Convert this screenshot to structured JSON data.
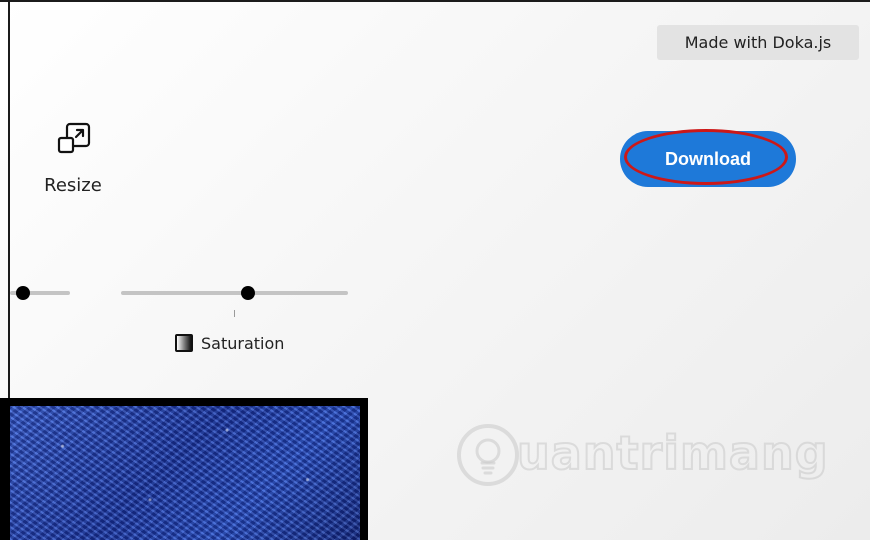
{
  "badge": {
    "text": "Made with Doka.js"
  },
  "tools": {
    "resize_label": "Resize"
  },
  "actions": {
    "download_label": "Download"
  },
  "adjustments": {
    "saturation_label": "Saturation",
    "left_slider_value": 0.22,
    "saturation_value": 0.56
  },
  "watermark": {
    "text": "uantrimang"
  },
  "colors": {
    "accent": "#1e79d9",
    "highlight_ring": "#cc1818",
    "track": "#c4c4c4",
    "knob": "#000000"
  }
}
